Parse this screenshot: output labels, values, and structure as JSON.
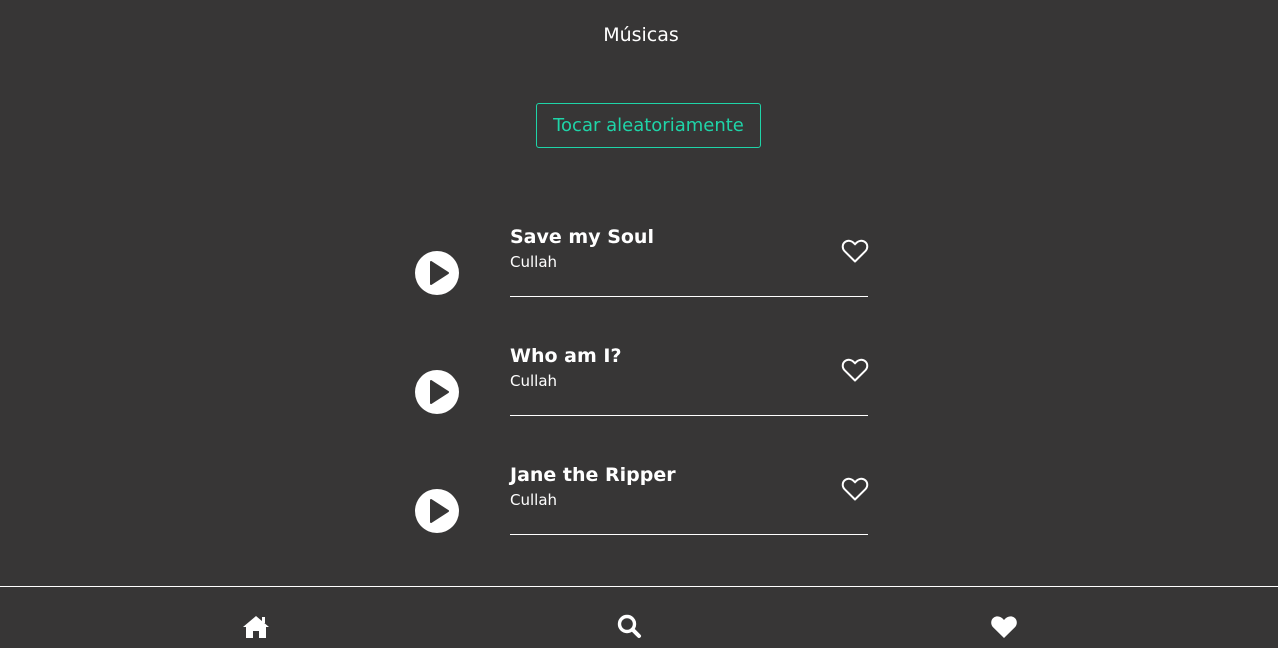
{
  "page": {
    "title": "Músicas",
    "shuffle_label": "Tocar aleatoriamente"
  },
  "songs": [
    {
      "title": "Save my Soul",
      "artist": "Cullah",
      "favorited": false
    },
    {
      "title": "Who am I?",
      "artist": "Cullah",
      "favorited": false
    },
    {
      "title": "Jane the Ripper",
      "artist": "Cullah",
      "favorited": false
    }
  ],
  "nav": {
    "items": [
      {
        "icon": "home-icon"
      },
      {
        "icon": "search-icon"
      },
      {
        "icon": "heart-icon"
      }
    ]
  },
  "colors": {
    "background": "#373636",
    "accent": "#1fd4a8",
    "foreground": "#ffffff"
  }
}
